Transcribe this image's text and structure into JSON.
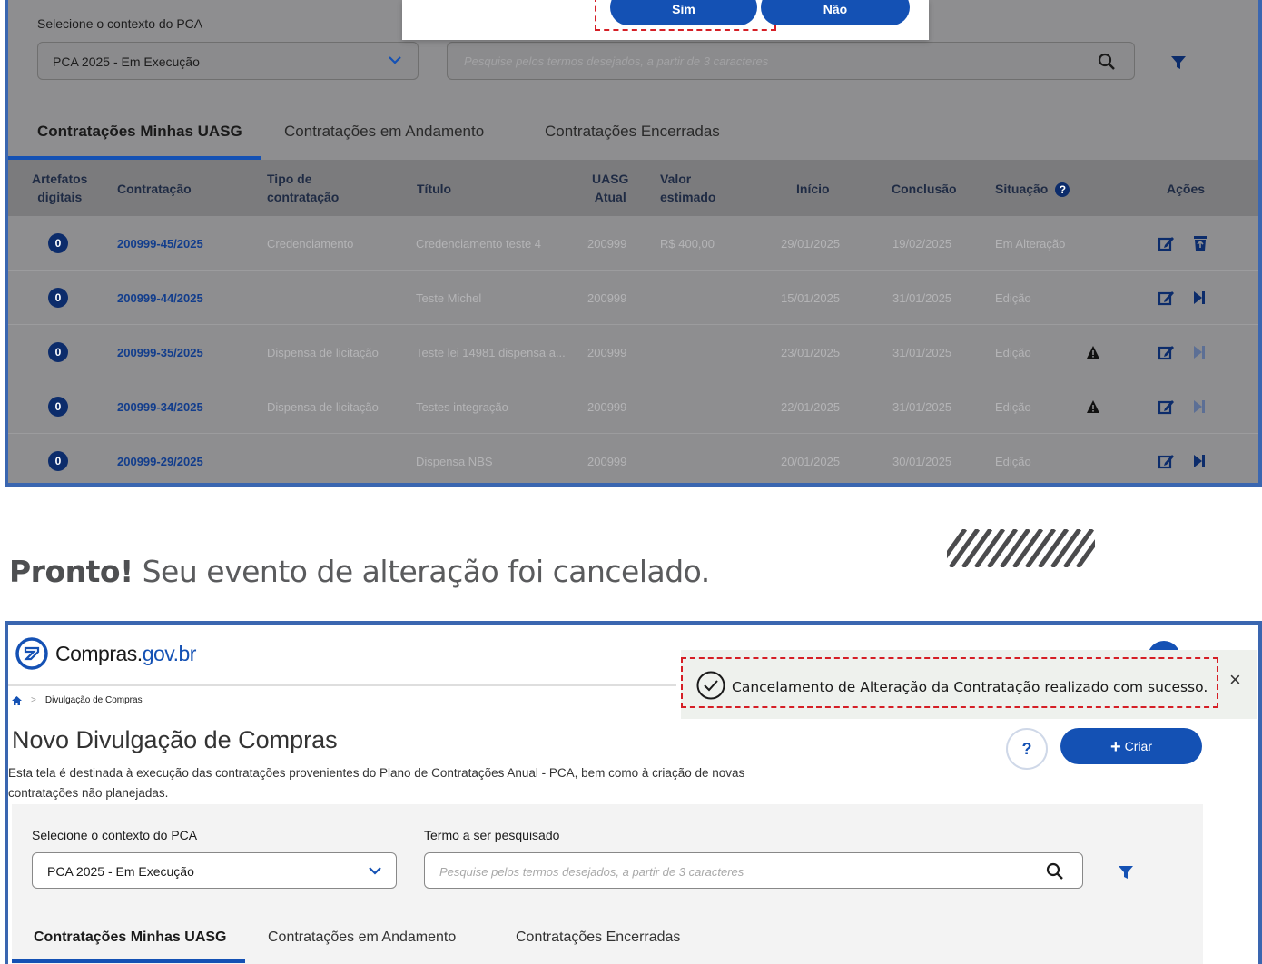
{
  "top": {
    "context_label": "Selecione o contexto do PCA",
    "context_value": "PCA 2025 - Em Execução",
    "search_placeholder": "Pesquise pelos termos desejados, a partir de 3 caracteres",
    "dialog": {
      "yes": "Sim",
      "no": "Não"
    },
    "tabs": [
      "Contratações Minhas UASG",
      "Contratações em Andamento",
      "Contratações Encerradas"
    ],
    "columns": {
      "artefatos_1": "Artefatos",
      "artefatos_2": "digitais",
      "contratacao": "Contratação",
      "tipo_1": "Tipo de",
      "tipo_2": "contratação",
      "titulo": "Título",
      "uasg_1": "UASG",
      "uasg_2": "Atual",
      "valor_1": "Valor",
      "valor_2": "estimado",
      "inicio": "Início",
      "conclusao": "Conclusão",
      "situacao": "Situação",
      "help": "?",
      "acoes": "Ações"
    },
    "rows": [
      {
        "badge": "0",
        "contratacao": "200999-45/2025",
        "tipo": "Credenciamento",
        "titulo": "Credenciamento teste 4",
        "uasg": "200999",
        "valor": "R$ 400,00",
        "inicio": "29/01/2025",
        "conclusao": "19/02/2025",
        "situacao": "Em Alteração"
      },
      {
        "badge": "0",
        "contratacao": "200999-44/2025",
        "tipo": "",
        "titulo": "Teste Michel",
        "uasg": "200999",
        "valor": "",
        "inicio": "15/01/2025",
        "conclusao": "31/01/2025",
        "situacao": "Edição"
      },
      {
        "badge": "0",
        "contratacao": "200999-35/2025",
        "tipo": "Dispensa de licitação",
        "titulo": "Teste lei 14981 dispensa a...",
        "uasg": "200999",
        "valor": "",
        "inicio": "23/01/2025",
        "conclusao": "31/01/2025",
        "situacao": "Edição"
      },
      {
        "badge": "0",
        "contratacao": "200999-34/2025",
        "tipo": "Dispensa de licitação",
        "titulo": "Testes integração",
        "uasg": "200999",
        "valor": "",
        "inicio": "22/01/2025",
        "conclusao": "31/01/2025",
        "situacao": "Edição"
      },
      {
        "badge": "0",
        "contratacao": "200999-29/2025",
        "tipo": "",
        "titulo": "Dispensa NBS",
        "uasg": "200999",
        "valor": "",
        "inicio": "20/01/2025",
        "conclusao": "30/01/2025",
        "situacao": "Edição"
      }
    ]
  },
  "message": {
    "bold": "Pronto!",
    "text": " Seu evento de alteração foi cancelado."
  },
  "bottom": {
    "brand_main": "Compras.",
    "brand_gov": "gov.br",
    "breadcrumb": "Divulgação de Compras",
    "title": "Novo Divulgação de Compras",
    "description": "Esta tela é destinada à execução das contratações provenientes do Plano de Contratações Anual - PCA, bem como à criação de novas contratações não planejadas.",
    "help": "?",
    "create": "Criar",
    "toast": "Cancelamento de Alteração da Contratação realizado com sucesso.",
    "toast_close": "×",
    "context_label": "Selecione o contexto do PCA",
    "context_value": "PCA 2025 - Em Execução",
    "search_label": "Termo a ser pesquisado",
    "search_placeholder": "Pesquise pelos termos desejados, a partir de 3 caracteres",
    "tabs": [
      "Contratações Minhas UASG",
      "Contratações em Andamento",
      "Contratações Encerradas"
    ]
  },
  "colors": {
    "primary": "#1451b4",
    "frame": "#3a66b0",
    "highlight": "#d51f26",
    "toast_bg": "#eef1ed"
  },
  "icons": [
    "chevron-down-icon",
    "search-icon",
    "filter-icon",
    "help-icon",
    "edit-icon",
    "delete-icon",
    "forward-icon",
    "warning-icon",
    "home-icon",
    "check-circle-icon",
    "close-icon",
    "plus-icon",
    "brand-logo-icon"
  ]
}
